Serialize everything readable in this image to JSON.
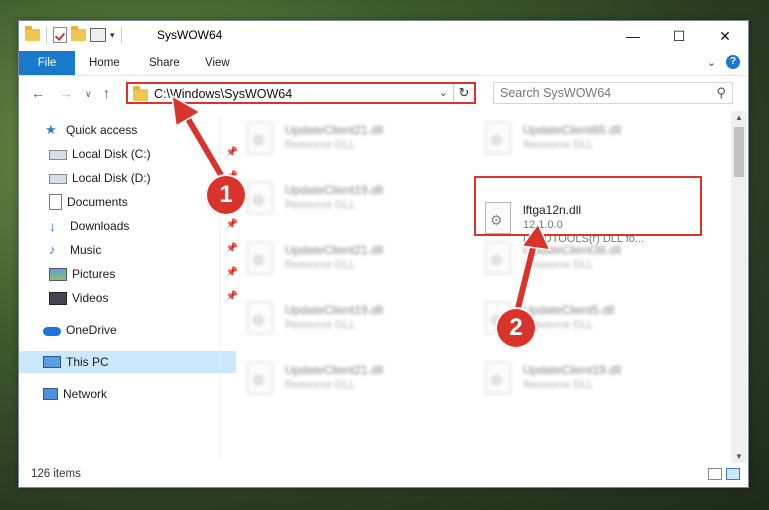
{
  "window": {
    "title": "SysWOW64",
    "controls": {
      "minimize": "—",
      "maximize": "☐",
      "close": "✕"
    }
  },
  "ribbon": {
    "tabs": [
      {
        "label": "File"
      },
      {
        "label": "Home"
      },
      {
        "label": "Share"
      },
      {
        "label": "View"
      }
    ]
  },
  "address": {
    "path": "C:\\Windows\\SysWOW64",
    "search_placeholder": "Search SysWOW64"
  },
  "nav": {
    "items": [
      {
        "label": "Quick access",
        "icon": "star-icon"
      },
      {
        "label": "Local Disk (C:)",
        "icon": "disk-icon"
      },
      {
        "label": "Local Disk (D:)",
        "icon": "disk-icon"
      },
      {
        "label": "Documents",
        "icon": "documents-icon"
      },
      {
        "label": "Downloads",
        "icon": "downloads-icon"
      },
      {
        "label": "Music",
        "icon": "music-icon"
      },
      {
        "label": "Pictures",
        "icon": "pictures-icon"
      },
      {
        "label": "Videos",
        "icon": "videos-icon"
      },
      {
        "label": "OneDrive",
        "icon": "onedrive-icon"
      },
      {
        "label": "This PC",
        "icon": "pc-icon"
      },
      {
        "label": "Network",
        "icon": "network-icon"
      }
    ]
  },
  "files": [
    {
      "name": "UpdateClient21.dll",
      "desc": "Resource DLL"
    },
    {
      "name": "UpdateClient65.dll",
      "desc": "Resource DLL"
    },
    {
      "name": "UpdateClient19.dll",
      "desc": "Resource DLL"
    },
    {
      "name": "lftga12n.dll",
      "version": "12.1.0.0",
      "desc": "LEADTOOLS(r) DLL fo..."
    },
    {
      "name": "UpdateClient21.dll",
      "desc": "Resource DLL"
    },
    {
      "name": "UpdateClient38.dll",
      "desc": "Resource DLL"
    },
    {
      "name": "UpdateClient19.dll",
      "desc": "Resource DLL"
    },
    {
      "name": "UpdateClient5.dll",
      "desc": "Resource DLL"
    },
    {
      "name": "UpdateClient21.dll",
      "desc": "Resource DLL"
    },
    {
      "name": "UpdateClient19.dll",
      "desc": "Resource DLL"
    }
  ],
  "status": {
    "item_count": "126 items"
  },
  "annotations": {
    "step1": "1",
    "step2": "2"
  },
  "colors": {
    "accent": "#1979ca",
    "annotation": "#d9342b",
    "selection": "#cce8ff"
  }
}
